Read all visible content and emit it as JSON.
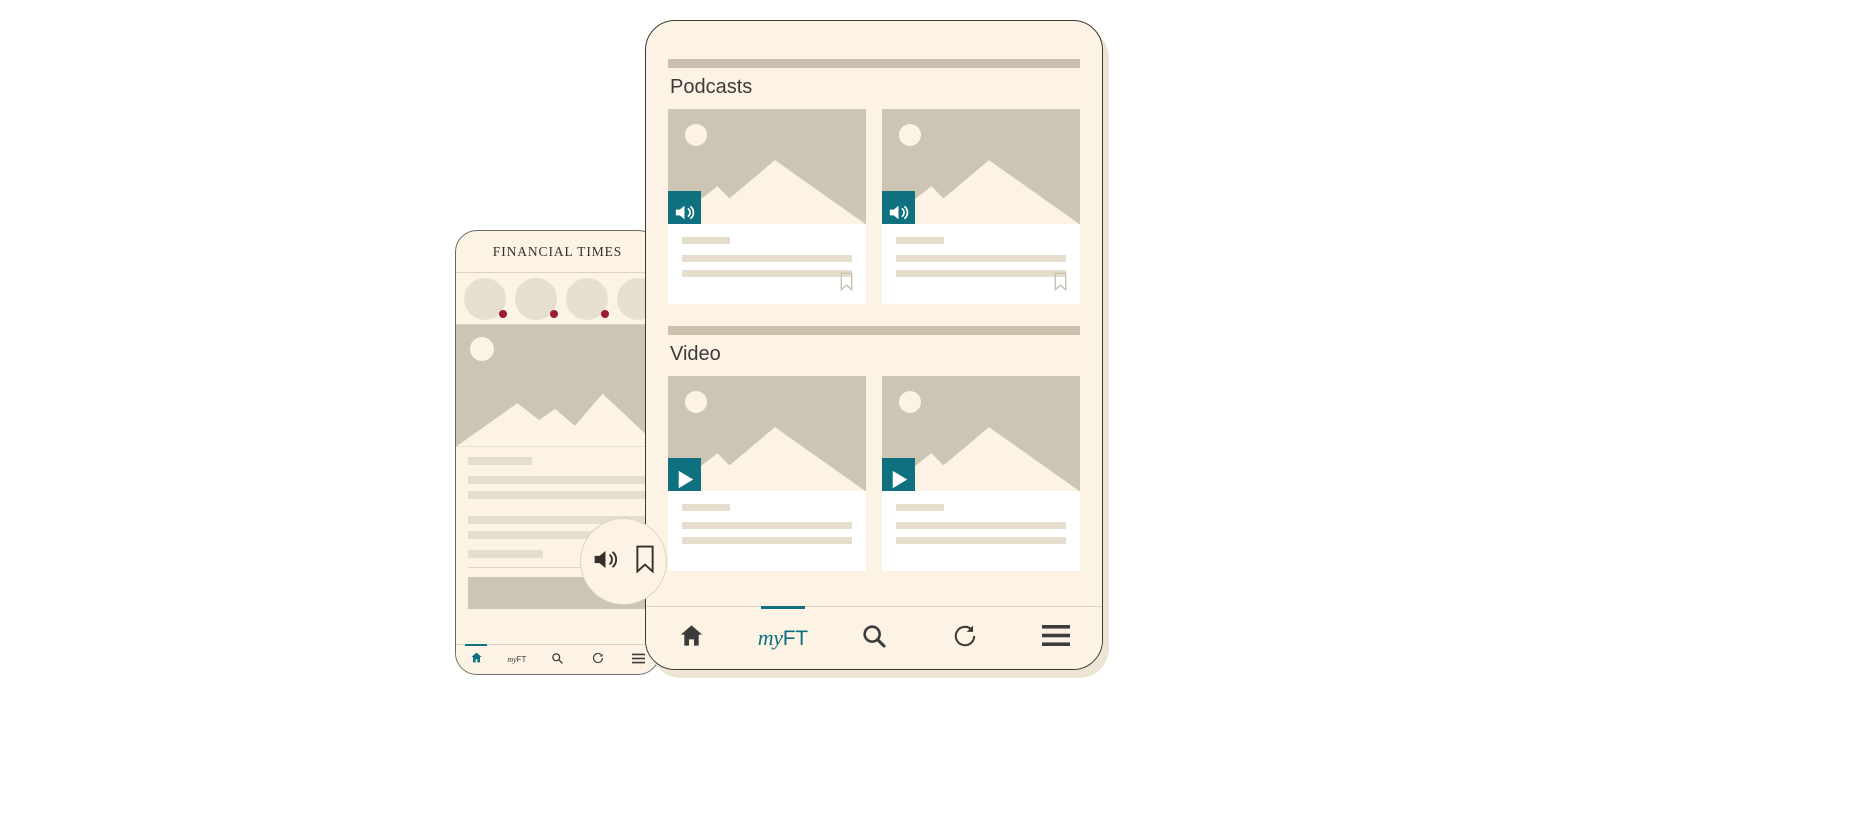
{
  "page": {
    "background": "#ffffff",
    "accent_teal": "#0F7180",
    "paper_cream": "#FCF3E4",
    "placeholder_gray": "#CCC5B4",
    "skeleton": "#E6DECD",
    "alert_red": "#9E1B32"
  },
  "phone": {
    "masthead": "FINANCIAL TIMES",
    "stories": [
      {
        "name": "story-avatar-1",
        "has_unread_dot": true
      },
      {
        "name": "story-avatar-2",
        "has_unread_dot": true
      },
      {
        "name": "story-avatar-3",
        "has_unread_dot": true
      },
      {
        "name": "story-avatar-4",
        "has_unread_dot": true
      },
      {
        "name": "story-avatar-5",
        "has_unread_dot": false
      }
    ],
    "nav": [
      {
        "icon": "home-icon",
        "label": "Home",
        "active": true
      },
      {
        "icon": "myft-icon",
        "label": "myFT",
        "label_italic": "my",
        "label_rest": "FT",
        "active": false
      },
      {
        "icon": "search-icon",
        "label": "Search",
        "active": false
      },
      {
        "icon": "refresh-icon",
        "label": "Refresh",
        "active": false
      },
      {
        "icon": "menu-icon",
        "label": "Menu",
        "active": false
      }
    ]
  },
  "tablet": {
    "sections": [
      {
        "title": "Podcasts",
        "badge_icon": "speaker-icon",
        "cards": [
          {
            "name": "podcast-card-1",
            "bookmark_icon": "bookmark-icon",
            "lines": 3
          },
          {
            "name": "podcast-card-2",
            "bookmark_icon": "bookmark-icon",
            "lines": 3
          }
        ]
      },
      {
        "title": "Video",
        "badge_icon": "play-icon",
        "cards": [
          {
            "name": "video-card-1",
            "bookmark_icon": "bookmark-icon",
            "lines": 3
          },
          {
            "name": "video-card-2",
            "bookmark_icon": "bookmark-icon",
            "lines": 3
          }
        ]
      }
    ],
    "nav": [
      {
        "icon": "home-icon",
        "label": "Home",
        "active": false
      },
      {
        "icon": "myft-icon",
        "label": "myFT",
        "label_italic": "my",
        "label_rest": "FT",
        "active": true
      },
      {
        "icon": "search-icon",
        "label": "Search",
        "active": false
      },
      {
        "icon": "refresh-icon",
        "label": "Refresh",
        "active": false
      },
      {
        "icon": "menu-icon",
        "label": "Menu",
        "active": false
      }
    ]
  },
  "overlay": {
    "name": "audio-bookmark-overlay",
    "speaker_icon": "speaker-icon",
    "bookmark_icon": "bookmark-icon"
  }
}
